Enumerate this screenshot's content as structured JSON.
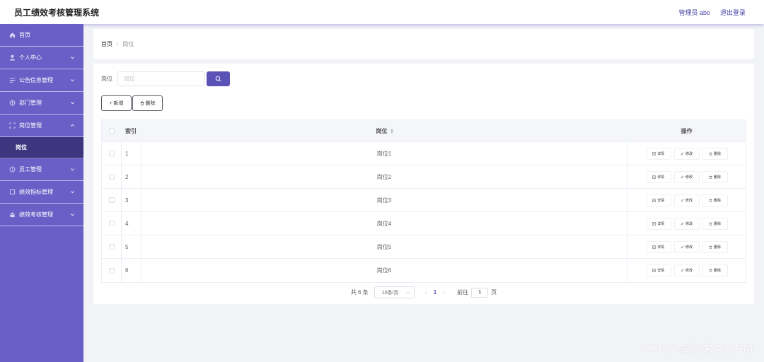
{
  "app": {
    "title": "员工绩效考核管理系统"
  },
  "header": {
    "user_label": "管理员 abo",
    "logout": "退出登录"
  },
  "sidebar": {
    "items": [
      {
        "label": "首页",
        "icon": "home-icon",
        "expandable": false
      },
      {
        "label": "个人中心",
        "icon": "user-icon",
        "expandable": true
      },
      {
        "label": "公告信息管理",
        "icon": "notice-icon",
        "expandable": true
      },
      {
        "label": "部门管理",
        "icon": "department-icon",
        "expandable": true
      },
      {
        "label": "岗位管理",
        "icon": "position-icon",
        "expandable": true,
        "expanded": true,
        "children": [
          {
            "label": "岗位",
            "active": true
          }
        ]
      },
      {
        "label": "员工管理",
        "icon": "employee-icon",
        "expandable": true
      },
      {
        "label": "绩效指标管理",
        "icon": "indicator-icon",
        "expandable": true
      },
      {
        "label": "绩效考核管理",
        "icon": "appraisal-icon",
        "expandable": true
      }
    ]
  },
  "breadcrumb": {
    "home": "首页",
    "separator": "/",
    "current": "岗位"
  },
  "search": {
    "label": "岗位",
    "placeholder": "岗位",
    "value": ""
  },
  "actions": {
    "add": "新增",
    "delete": "删除"
  },
  "table": {
    "headers": {
      "index": "索引",
      "position": "岗位",
      "ops": "操作"
    },
    "rows": [
      {
        "index": "1",
        "position": "岗位1"
      },
      {
        "index": "2",
        "position": "岗位2"
      },
      {
        "index": "3",
        "position": "岗位3"
      },
      {
        "index": "4",
        "position": "岗位4"
      },
      {
        "index": "5",
        "position": "岗位5"
      },
      {
        "index": "6",
        "position": "岗位6"
      }
    ],
    "row_ops": {
      "detail": "详情",
      "edit": "修改",
      "delete": "删除"
    }
  },
  "pagination": {
    "total_text": "共 6 条",
    "page_size": "10条/页",
    "prev": "‹",
    "current_page": "1",
    "next": "›",
    "goto_label": "前往",
    "goto_value": "1",
    "page_unit": "页"
  },
  "watermark": "CSDN @夜未央5788",
  "colors": {
    "sidebar": "#6a5fc7",
    "sidebar_active": "#3e357f",
    "accent": "#5b52b8"
  }
}
